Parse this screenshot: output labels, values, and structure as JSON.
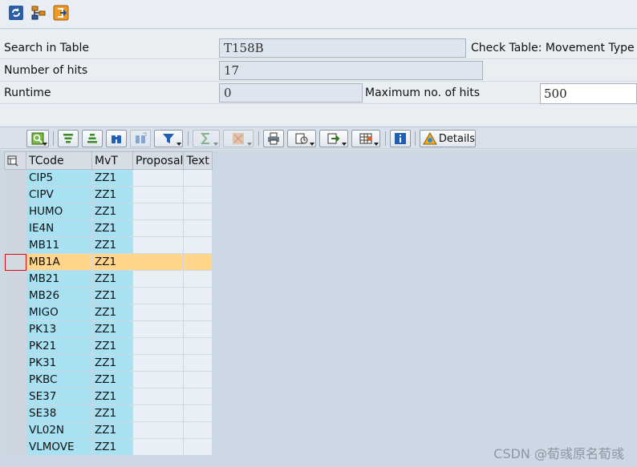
{
  "toolbar": {
    "icons": [
      "refresh-icon",
      "hierarchy-icon",
      "jump-icon"
    ]
  },
  "header": {
    "search_label": "Search in Table",
    "search_value": "T158B",
    "check_table": "Check Table: Movement Type",
    "hits_label": "Number of hits",
    "hits_value": "17",
    "runtime_label": "Runtime",
    "runtime_value": "0",
    "max_hits_label": "Maximum no. of hits",
    "max_hits_value": "500"
  },
  "alv_toolbar": {
    "details_label": "Details",
    "icons": [
      "find-icon",
      "sort-ascending-icon",
      "sort-descending-icon",
      "binoculars-icon",
      "binoculars-next-icon",
      "filter-icon",
      "sum-icon",
      "subtotal-icon",
      "print-icon",
      "view-icon",
      "export-icon",
      "layout-icon",
      "info-icon",
      "details-icon"
    ]
  },
  "grid": {
    "columns": [
      "TCode",
      "MvT",
      "Proposal",
      "Text"
    ],
    "rows": [
      {
        "tcode": "CIP5",
        "mvt": "ZZ1"
      },
      {
        "tcode": "CIPV",
        "mvt": "ZZ1"
      },
      {
        "tcode": "HUMO",
        "mvt": "ZZ1"
      },
      {
        "tcode": "IE4N",
        "mvt": "ZZ1"
      },
      {
        "tcode": "MB11",
        "mvt": "ZZ1"
      },
      {
        "tcode": "MB1A",
        "mvt": "ZZ1"
      },
      {
        "tcode": "MB21",
        "mvt": "ZZ1"
      },
      {
        "tcode": "MB26",
        "mvt": "ZZ1"
      },
      {
        "tcode": "MIGO",
        "mvt": "ZZ1"
      },
      {
        "tcode": "PK13",
        "mvt": "ZZ1"
      },
      {
        "tcode": "PK21",
        "mvt": "ZZ1"
      },
      {
        "tcode": "PK31",
        "mvt": "ZZ1"
      },
      {
        "tcode": "PKBC",
        "mvt": "ZZ1"
      },
      {
        "tcode": "SE37",
        "mvt": "ZZ1"
      },
      {
        "tcode": "SE38",
        "mvt": "ZZ1"
      },
      {
        "tcode": "VL02N",
        "mvt": "ZZ1"
      },
      {
        "tcode": "VLMOVE",
        "mvt": "ZZ1"
      }
    ],
    "highlighted_row_tcode": "MB1A"
  },
  "watermark": "CSDN @荀彧原名荀彧",
  "colors": {
    "key_cell": "#a8e2f2",
    "highlight_row": "#ffd68a",
    "background": "#dfe6ee"
  }
}
